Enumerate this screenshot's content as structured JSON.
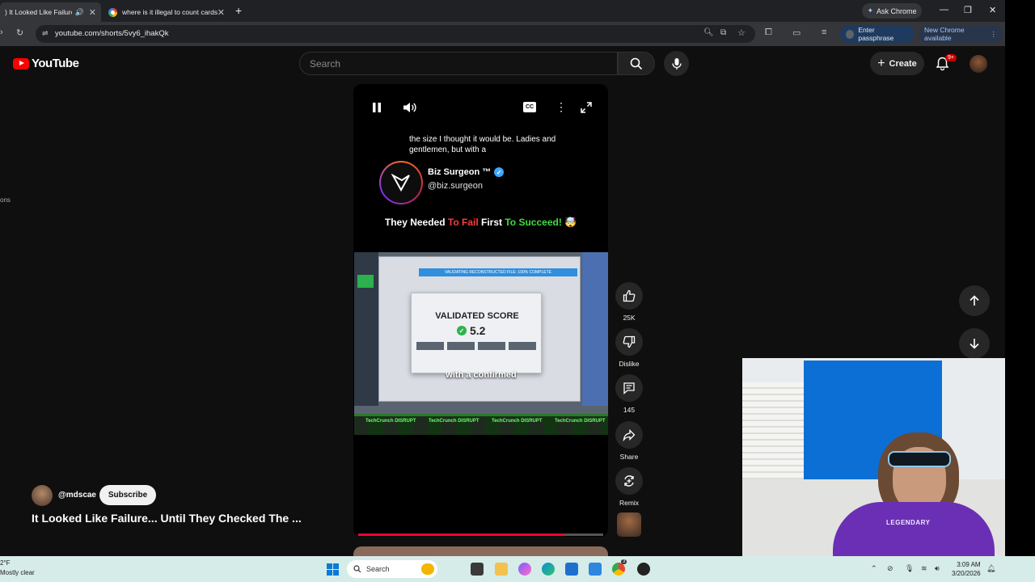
{
  "browser": {
    "tabs": [
      {
        "title": ") It Looked Like Failure...",
        "active": true
      },
      {
        "title": "where is it illegal to count cards",
        "active": false
      }
    ],
    "ask_chrome": "Ask Chrome",
    "url": "youtube.com/shorts/5vy6_ihakQk",
    "passphrase_btn": "Enter passphrase",
    "update_btn": "New Chrome available"
  },
  "yt": {
    "logo_text": "YouTube",
    "search_placeholder": "Search",
    "create_label": "Create",
    "notif_badge": "9+",
    "left_cut_text": "ons"
  },
  "player": {
    "caption_top": "the size I thought it would be. Ladies and gentlemen, but with a",
    "card_name": "Biz Surgeon ™",
    "card_handle": "@biz.surgeon",
    "headline": {
      "p1": "They Needed ",
      "p2": "To Fail",
      "p3": " First ",
      "p4": "To Succeed!",
      "p5": " 🤯"
    },
    "screen_bar": "VALIDATING RECONSTRUCTED FILE: 100% COMPLETE",
    "dialog_title": "VALIDATED SCORE",
    "dialog_score": "5.2",
    "video_caption": "with a confirmed",
    "tc_label": "TechCrunch DISRUPT",
    "progress_fraction": 0.84
  },
  "actions": {
    "likes": "25K",
    "dislike": "Dislike",
    "comments": "145",
    "share": "Share",
    "remix": "Remix"
  },
  "video_meta": {
    "channel_handle": "@mdscae",
    "subscribe": "Subscribe",
    "title": "It Looked Like Failure... Until They Checked The ..."
  },
  "webcam": {
    "shirt_text": "LEGENDARY"
  },
  "taskbar": {
    "weather_temp": "2°F",
    "weather_desc": "Mostly clear",
    "search_label": "Search",
    "time": "3:09 AM",
    "date": "3/20/2026",
    "chrome_badge": "3"
  }
}
